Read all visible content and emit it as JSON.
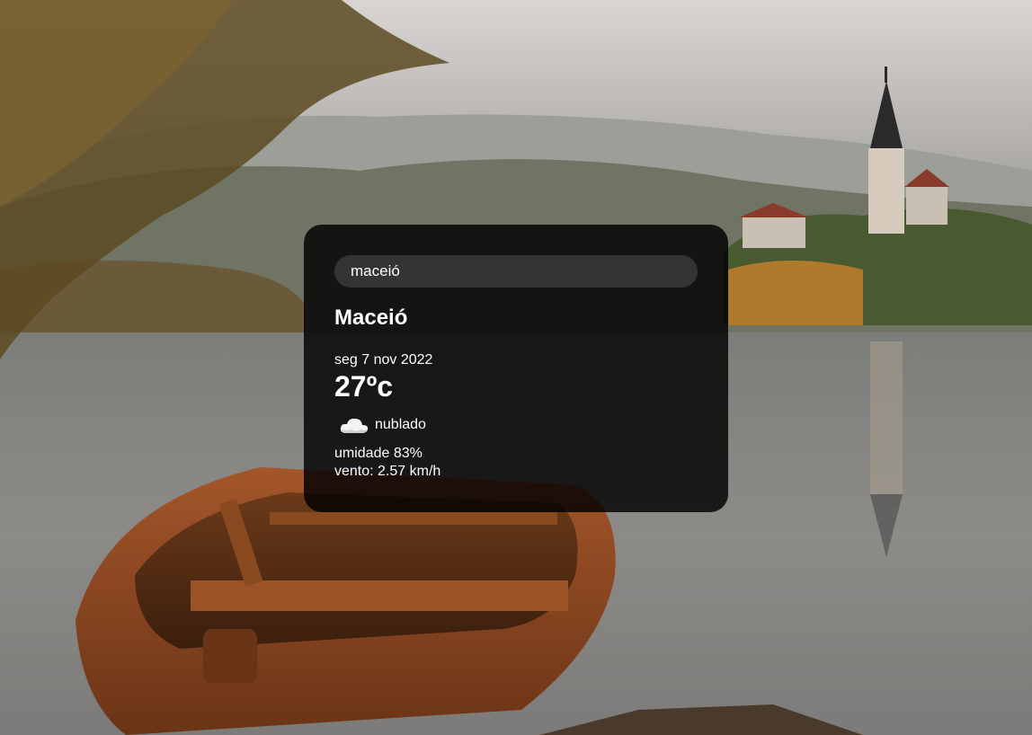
{
  "background": {
    "scene": "lake-with-boat-and-church"
  },
  "search": {
    "value": "maceió",
    "placeholder": ""
  },
  "weather": {
    "city": "Maceió",
    "date": "seg 7 nov 2022",
    "temperature": "27ºc",
    "condition": "nublado",
    "condition_icon": "cloud-icon",
    "humidity": "umidade 83%",
    "wind": "vento: 2.57 km/h"
  },
  "colors": {
    "card_bg": "#000000",
    "text": "#ffffff"
  }
}
